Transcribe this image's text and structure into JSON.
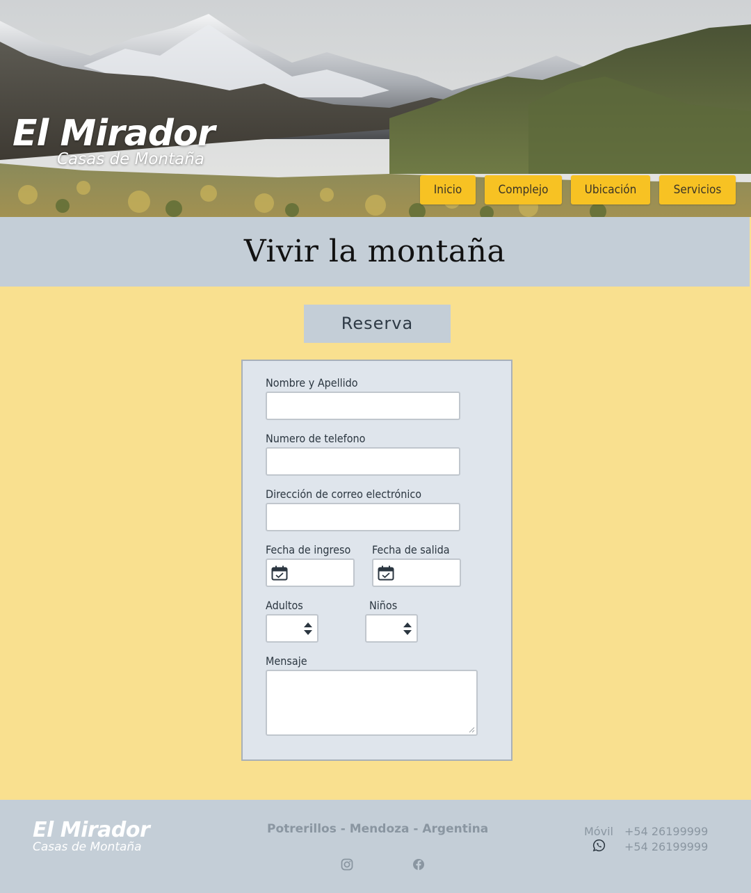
{
  "brand": {
    "name": "El Mirador",
    "subtitle": "Casas de Montaña"
  },
  "nav": [
    {
      "label": "Inicio"
    },
    {
      "label": "Complejo"
    },
    {
      "label": "Ubicación"
    },
    {
      "label": "Servicios"
    }
  ],
  "tagline": "Vivir la montaña",
  "reserva_label": "Reserva",
  "form": {
    "name_label": "Nombre y Apellido",
    "phone_label": "Numero de telefono",
    "email_label": "Dirección de correo electrónico",
    "checkin_label": "Fecha de ingreso",
    "checkout_label": "Fecha de salida",
    "adults_label": "Adultos",
    "children_label": "Niños",
    "message_label": "Mensaje"
  },
  "footer": {
    "name": "El Mirador",
    "subtitle": "Casas de Montaña",
    "location": "Potrerillos - Mendoza - Argentina",
    "mobile_label": "Móvil",
    "mobile_number": "+54 26199999",
    "whatsapp_number": "+54 26199999"
  },
  "colors": {
    "accent": "#f7c223",
    "page_bg": "#f9e08f",
    "band_bg": "#c4ced7",
    "form_bg": "#dfe5ec"
  },
  "icons": [
    "calendar-icon",
    "spinner-arrows-icon",
    "whatsapp-icon",
    "instagram-icon",
    "facebook-icon"
  ]
}
